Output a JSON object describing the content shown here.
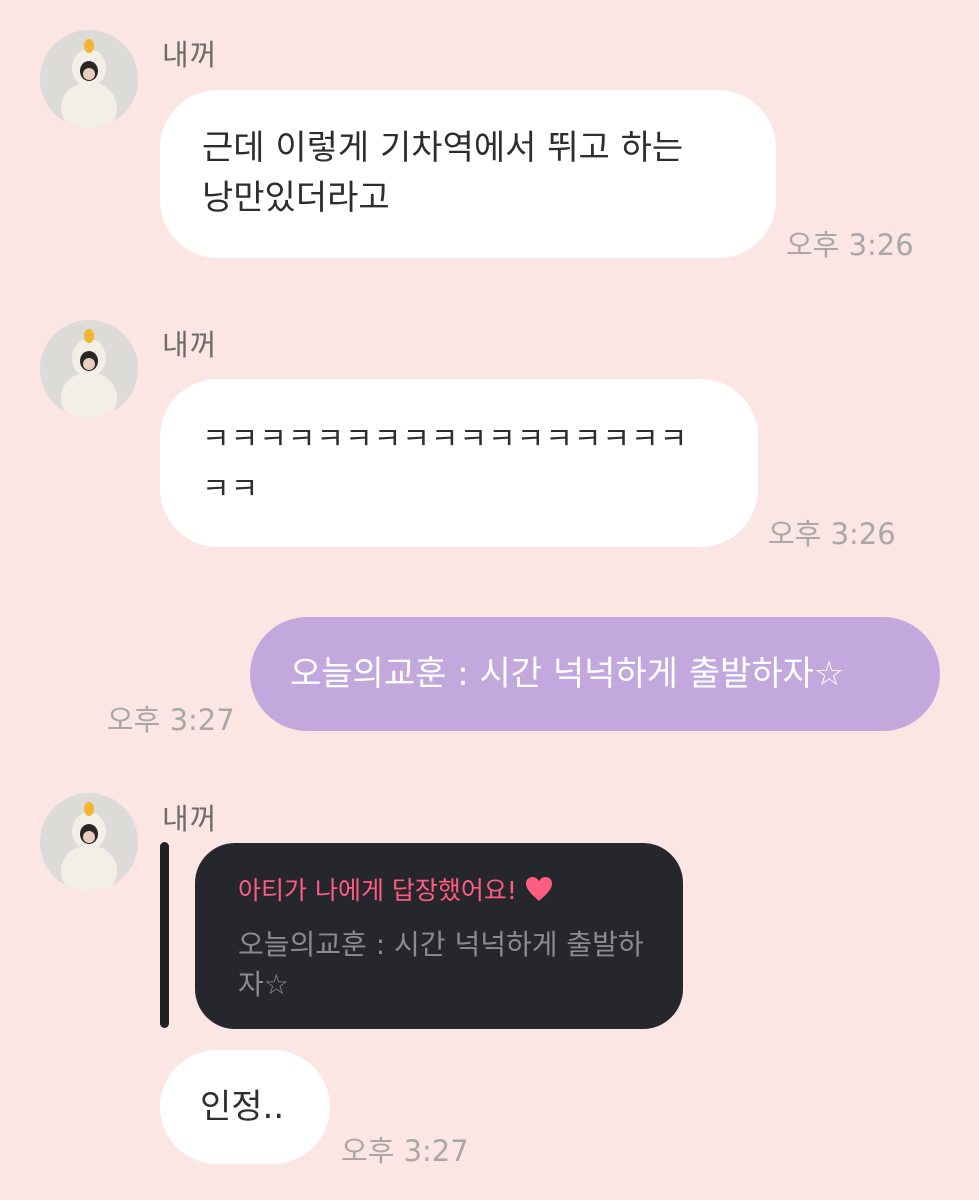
{
  "messages": [
    {
      "sender": "내꺼",
      "lines": [
        "근데 이렇게 기차역에서 뛰고 하는",
        "낭만있더라고"
      ],
      "time": "오후 3:26"
    },
    {
      "sender": "내꺼",
      "lines": [
        "ㅋㅋㅋㅋㅋㅋㅋㅋㅋㅋㅋㅋㅋㅋㅋㅋㅋ",
        "ㅋㅋ"
      ],
      "time": "오후 3:26"
    },
    {
      "text": "오늘의교훈 : 시간 넉넉하게 출발하자☆",
      "time": "오후 3:27",
      "bubble_color": "#c2a8dc"
    },
    {
      "sender": "내꺼",
      "reply_header": "아티가 나에게 답장했어요!",
      "reply_quote": "오늘의교훈 : 시간 넉넉하게 출발하자☆",
      "text": "인정..",
      "time": "오후 3:27",
      "accent_color": "#ff5c82"
    }
  ],
  "icons": {
    "heart": "heart-icon",
    "avatar": "avatar"
  },
  "colors": {
    "background": "#fce6e3",
    "incoming_bubble": "#ffffff",
    "outgoing_bubble": "#c2a8dc",
    "reply_card": "#26262d"
  }
}
